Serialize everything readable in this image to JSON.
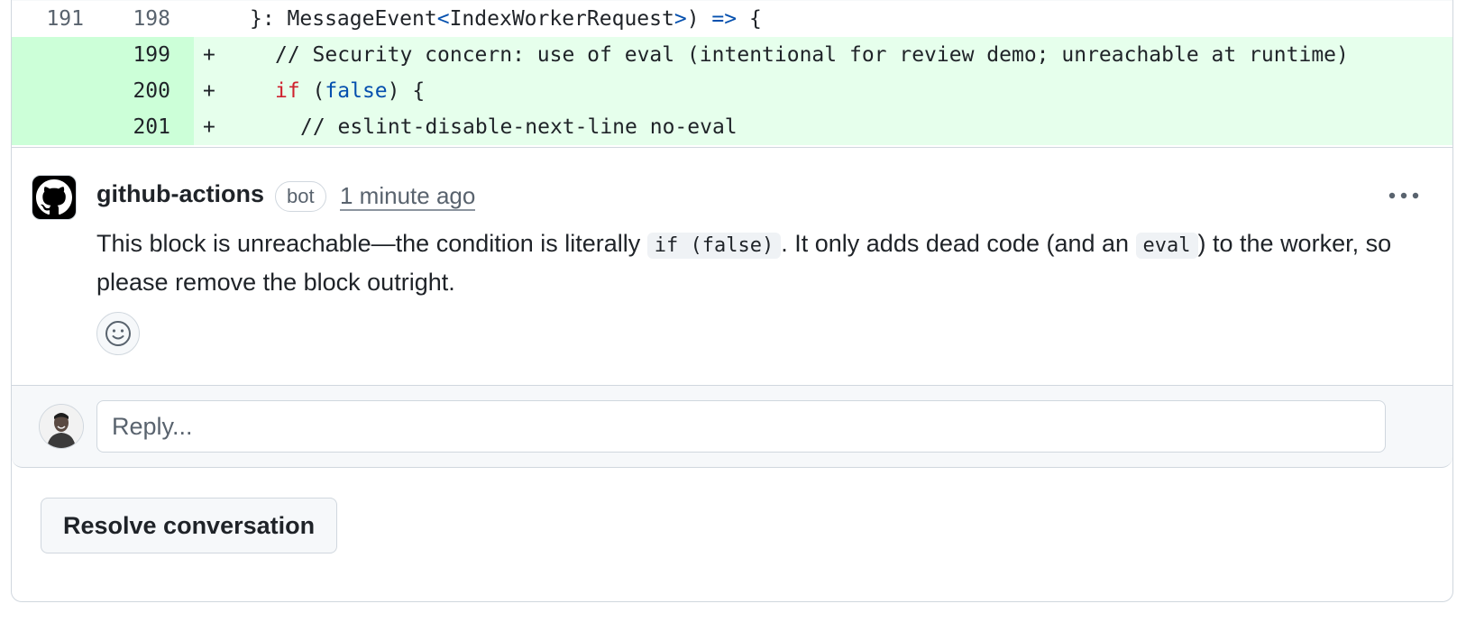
{
  "diff": {
    "context_row": {
      "old_line": "191",
      "new_line": "198",
      "code_prefix": "}: MessageEvent",
      "code_lt": "<",
      "code_type": "IndexWorkerRequest",
      "code_gt": ">",
      "code_paren": ")",
      "code_arrow": "=>",
      "code_brace": "{"
    },
    "added_rows": [
      {
        "new_line": "199",
        "marker": "+",
        "comment": "// Security concern: use of eval (intentional for review demo; unreachable at runtime)"
      },
      {
        "new_line": "200",
        "marker": "+",
        "kw": "if",
        "open": " (",
        "val": "false",
        "close": ") {"
      },
      {
        "new_line": "201",
        "marker": "+",
        "comment": "// eslint-disable-next-line no-eval"
      }
    ]
  },
  "comment": {
    "author": "github-actions",
    "badge": "bot",
    "timestamp": "1 minute ago",
    "menu_icon": "kebab-horizontal-icon",
    "body_part1": "This block is unreachable—the condition is literally ",
    "code1": "if (false)",
    "body_part2": ". It only adds dead code (and an ",
    "code2": "eval",
    "body_part3": ") to the worker, so please remove the block outright.",
    "reaction_icon": "smiley-icon"
  },
  "reply": {
    "placeholder": "Reply..."
  },
  "actions": {
    "resolve_label": "Resolve conversation"
  },
  "colors": {
    "added_bg": "#e6ffec",
    "added_num_bg": "#ccffd8",
    "keyword": "#cf222e",
    "literal": "#0550ae",
    "border": "#d0d7de"
  }
}
